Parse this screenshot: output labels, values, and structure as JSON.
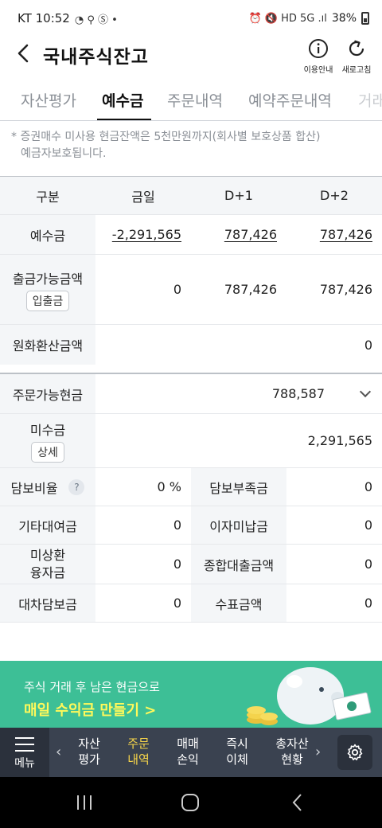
{
  "status_bar": {
    "carrier_time": "KT 10:52",
    "battery": "38%"
  },
  "header": {
    "title": "국내주식잔고",
    "info_label": "이용안내",
    "refresh_label": "새로고침"
  },
  "tabs": [
    {
      "label": "자산평가"
    },
    {
      "label": "예수금",
      "active": true
    },
    {
      "label": "주문내역"
    },
    {
      "label": "예약주문내역"
    },
    {
      "label": "거래"
    }
  ],
  "notice": {
    "line1": "* 증권매수 미사용 현금잔액은 5천만원까지(회사별 보호상품 합산)",
    "line2": "예금자보호됩니다."
  },
  "deposit_table": {
    "headers": [
      "구분",
      "금일",
      "D+1",
      "D+2"
    ],
    "deposit": {
      "label": "예수금",
      "today": "-2,291,565",
      "d1": "787,426",
      "d2": "787,426"
    },
    "withdrawable": {
      "label": "출금가능금액",
      "button": "입출금",
      "today": "0",
      "d1": "787,426",
      "d2": "787,426"
    },
    "krw_converted": {
      "label": "원화환산금액",
      "value": "0"
    }
  },
  "order_table": {
    "orderable_cash": {
      "label": "주문가능현금",
      "value": "788,587"
    },
    "unpaid": {
      "label": "미수금",
      "button": "상세",
      "value": "2,291,565"
    },
    "collateral_ratio": {
      "label": "담보비율",
      "help": "?",
      "value": "0 %"
    },
    "collateral_shortage": {
      "label": "담보부족금",
      "value": "0"
    },
    "other_loan": {
      "label": "기타대여금",
      "value": "0"
    },
    "unpaid_interest": {
      "label": "이자미납금",
      "value": "0"
    },
    "unrepaid_loan_1": "미상환",
    "unrepaid_loan_2": "융자금",
    "unrepaid_loan_value": "0",
    "total_loan": {
      "label": "종합대출금액",
      "value": "0"
    },
    "lending_collateral": {
      "label": "대차담보금",
      "value": "0"
    },
    "check_amount": {
      "label": "수표금액",
      "value": "0"
    }
  },
  "banner": {
    "subtitle": "주식 거래 후 남은 현금으로",
    "cta": "매일 수익금 만들기 >"
  },
  "bottom_nav": {
    "menu_label": "메뉴",
    "items": [
      {
        "line1": "자산",
        "line2": "평가"
      },
      {
        "line1": "주문",
        "line2": "내역",
        "active": true
      },
      {
        "line1": "매매",
        "line2": "손익"
      },
      {
        "line1": "즉시",
        "line2": "이체"
      },
      {
        "line1": "총자산",
        "line2": "현황"
      }
    ]
  },
  "colors": {
    "accent_green": "#3dbf96",
    "cta_yellow": "#fff95a",
    "nav_bg": "#3a4250",
    "nav_active": "#f7d54a"
  }
}
